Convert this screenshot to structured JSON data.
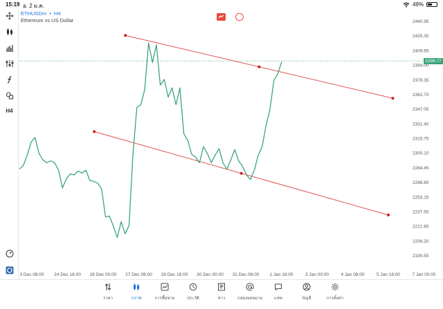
{
  "status_bar": {
    "time": "15:19",
    "date": "อ. 2 ม.ค.",
    "battery": "49%",
    "battery_level": 0.49
  },
  "symbol": {
    "name": "ETHUSDm",
    "separator": "•",
    "timeframe": "H4",
    "description": "Ethereum vs US Dollar"
  },
  "current_price": "2398.77",
  "colors": {
    "line": "#3aa57a",
    "trendline": "#e05050",
    "accent": "#1e6fd9"
  },
  "left_tools": [
    {
      "icon": "crosshair-icon"
    },
    {
      "icon": "candles-icon"
    },
    {
      "icon": "bars-icon"
    },
    {
      "icon": "indicators-icon"
    },
    {
      "icon": "function-icon"
    },
    {
      "icon": "shapes-icon"
    },
    {
      "icon": "timeframe-icon",
      "label": "H4"
    },
    {
      "icon": "speedometer-icon"
    },
    {
      "icon": "sync-icon"
    }
  ],
  "chart_data": {
    "type": "line",
    "title": "",
    "price_axis": [
      "2440.95",
      "2425.30",
      "2409.65",
      "2394.00",
      "2378.35",
      "2362.70",
      "2347.05",
      "2331.40",
      "2315.75",
      "2300.10",
      "2284.45",
      "2268.80",
      "2253.15",
      "2237.50",
      "2221.85",
      "2206.20",
      "2190.55"
    ],
    "time_axis": [
      "3 Dec 08:00",
      "24 Dec 16:00",
      "26 Dec 00:00",
      "27 Dec 08:00",
      "28 Dec 16:00",
      "30 Dec 00:00",
      "31 Dec 08:00",
      "1 Jan 16:00",
      "3 Jan 00:00",
      "4 Jan 08:00",
      "5 Jan 16:00",
      "7 Jan 00:00"
    ],
    "ylim": [
      2190.55,
      2440.95
    ],
    "series": [
      {
        "values": [
          2283,
          2287,
          2298,
          2312,
          2317,
          2300,
          2293,
          2290,
          2292,
          2290,
          2282,
          2263,
          2273,
          2278,
          2277,
          2281,
          2279,
          2282,
          2271,
          2270,
          2268,
          2262,
          2232,
          2233,
          2222,
          2210,
          2227,
          2214,
          2223,
          2298,
          2349,
          2352,
          2368,
          2418,
          2397,
          2416,
          2373,
          2379,
          2360,
          2370,
          2352,
          2370,
          2321,
          2314,
          2299,
          2296,
          2290,
          2307,
          2300,
          2290,
          2298,
          2305,
          2290,
          2283,
          2293,
          2304,
          2292,
          2286,
          2277,
          2272,
          2282,
          2298,
          2307,
          2330,
          2347,
          2378,
          2385,
          2398
        ]
      }
    ],
    "trendlines": [
      {
        "p1": {
          "time": "26 Dec 20:00",
          "price": 2426.0
        },
        "p2": {
          "time": "5 Jan 20:00",
          "price": 2358.9
        }
      },
      {
        "p1": {
          "time": "25 Dec 16:00",
          "price": 2323.2
        },
        "p2": {
          "time": "5 Jan 16:00",
          "price": 2234.1
        }
      }
    ]
  },
  "bottom_nav": [
    {
      "icon": "quotes-icon",
      "label": "ราคา"
    },
    {
      "icon": "chart-icon",
      "label": "กราฟ"
    },
    {
      "icon": "trade-icon",
      "label": "การซื้อขาย"
    },
    {
      "icon": "history-icon",
      "label": "ประวัติ"
    },
    {
      "icon": "news-icon",
      "label": "ข่าว"
    },
    {
      "icon": "mailbox-icon",
      "label": "กล่องจดหมาย"
    },
    {
      "icon": "chat-icon",
      "label": "แชท"
    },
    {
      "icon": "account-icon",
      "label": "บัญชี"
    },
    {
      "icon": "settings-icon",
      "label": "การตั้งค่า"
    }
  ]
}
